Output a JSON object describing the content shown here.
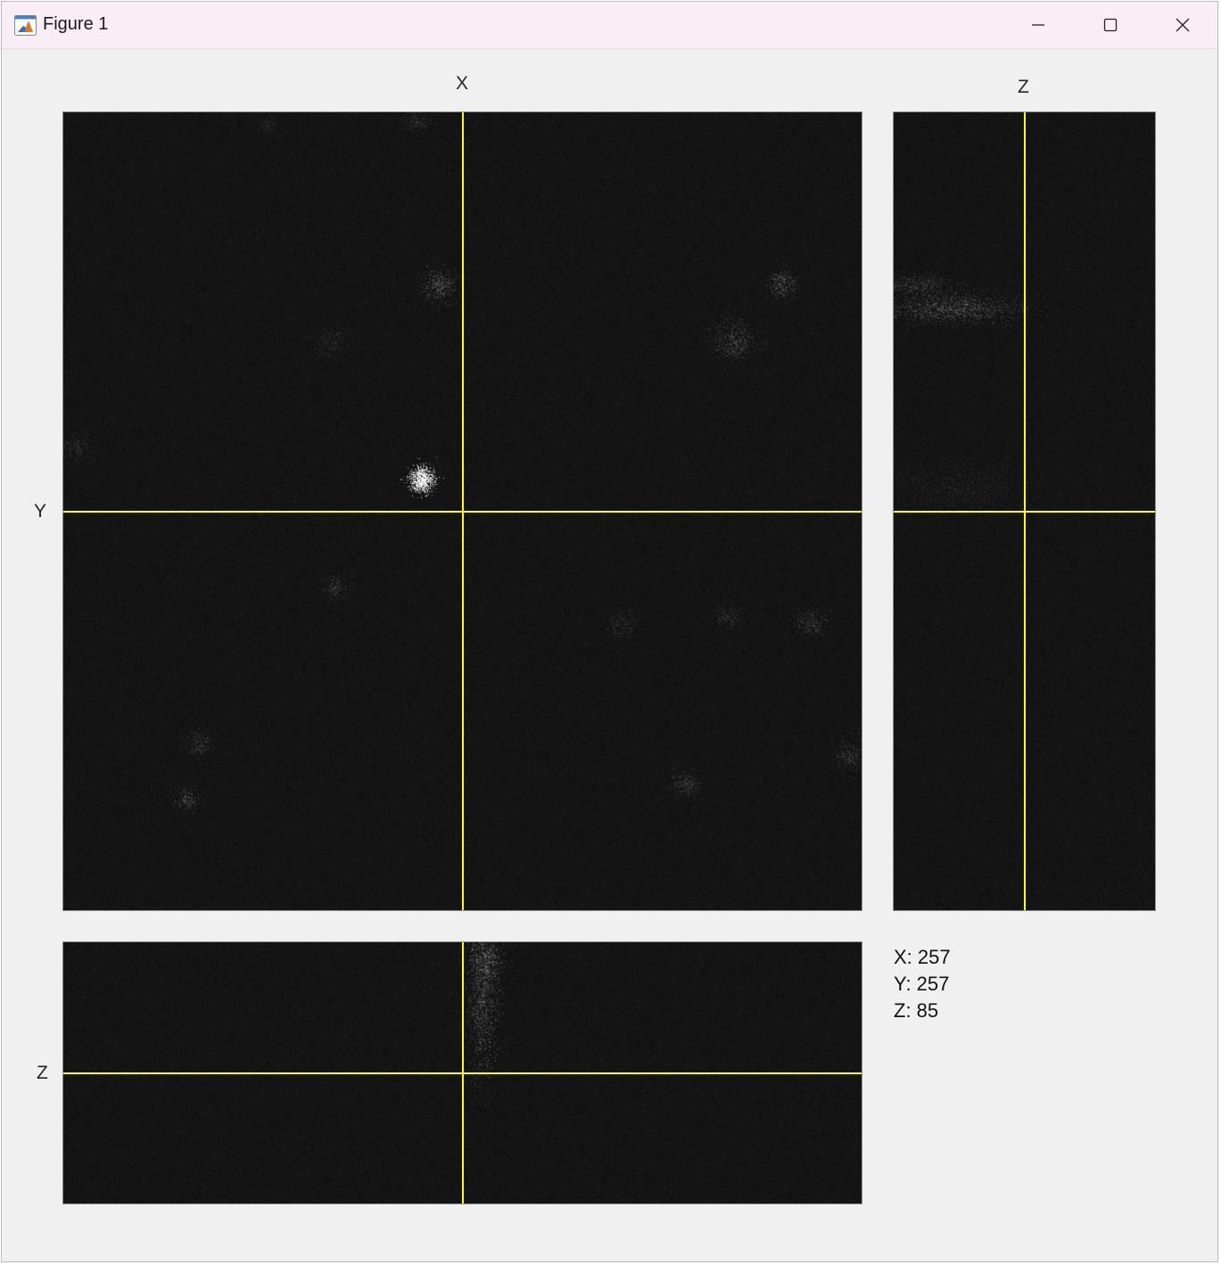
{
  "window": {
    "title": "Figure 1",
    "icon": "matlab-icon",
    "controls": [
      "minimize-icon",
      "maximize-icon",
      "close-icon"
    ]
  },
  "views": {
    "xy": {
      "top_label": "X",
      "side_label": "Y"
    },
    "zy": {
      "top_label": "Z"
    },
    "xz": {
      "side_label": "Z"
    }
  },
  "crosshair": {
    "color": "#ffff00"
  },
  "readout": {
    "x": "X: 257",
    "y": "Y: 257",
    "z": "Z: 85"
  }
}
